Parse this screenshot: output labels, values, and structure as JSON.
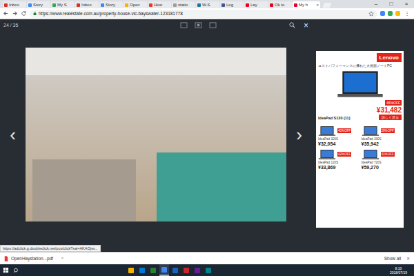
{
  "browser": {
    "tabs": [
      {
        "label": "Inbox",
        "selected": false,
        "color": "#d93025"
      },
      {
        "label": "Story",
        "selected": false,
        "color": "#4285f4"
      },
      {
        "label": "My S",
        "selected": false,
        "color": "#34a853"
      },
      {
        "label": "Inbox",
        "selected": false,
        "color": "#d93025"
      },
      {
        "label": "Story",
        "selected": false,
        "color": "#4285f4"
      },
      {
        "label": "Open",
        "selected": false,
        "color": "#f4b400"
      },
      {
        "label": "How",
        "selected": false,
        "color": "#e53935"
      },
      {
        "label": "statio",
        "selected": false,
        "color": "#9e9e9e"
      },
      {
        "label": "W-S",
        "selected": false,
        "color": "#21759b"
      },
      {
        "label": "Log",
        "selected": false,
        "color": "#3b5998"
      },
      {
        "label": "Lay",
        "selected": false,
        "color": "#e60023"
      },
      {
        "label": "Ok to",
        "selected": false,
        "color": "#e60023"
      },
      {
        "label": "My h",
        "selected": true,
        "color": "#e4002b"
      }
    ],
    "tab_close": "×",
    "window_controls": [
      "–",
      "□",
      "×"
    ],
    "url": "https://www.realestate.com.au/property-house-vic-bayswater-123181778",
    "menu": "⋮",
    "extensions": [
      {
        "color": "#4285f4"
      },
      {
        "color": "#34a853"
      },
      {
        "color": "#fbbc05"
      }
    ]
  },
  "gallery": {
    "counter": "24 / 35",
    "close": "×",
    "prev": "‹",
    "next": "›"
  },
  "ad": {
    "brand": "Lenovo",
    "headline": "コストパフォーマンスに優れた大画面ノートPC",
    "badge": "45%OFF",
    "product": "IdeaPad S130 (11)",
    "price": "¥31,482",
    "cta": "詳しく見る",
    "items": [
      {
        "name": "IdeaPad 320S",
        "badge": "40%OFF",
        "price": "¥32,054"
      },
      {
        "name": "IdeaPad 330S",
        "badge": "29%OFF",
        "price": "¥35,942"
      },
      {
        "name": "IdeaPad 120S",
        "badge": "42%OFF",
        "price": "¥33,869"
      },
      {
        "name": "IdeaPad 720S",
        "badge": "31%OFF",
        "price": "¥59,270"
      }
    ]
  },
  "status_url": "https://adclick.g.doubleclick.net/pcs/click?xai=AKAOjsv...",
  "downloads": {
    "file": "OpenHaystation...pdf",
    "caret": "^",
    "show_all": "Show all",
    "close": "×"
  },
  "taskbar": {
    "apps": [
      {
        "color": "#f4b400",
        "selected": false
      },
      {
        "color": "#0078d7",
        "selected": false
      },
      {
        "color": "#2e7d32",
        "selected": false
      },
      {
        "color": "#4285f4",
        "selected": true
      },
      {
        "color": "#1565c0",
        "selected": false
      },
      {
        "color": "#c62828",
        "selected": false
      },
      {
        "color": "#6a1b9a",
        "selected": false
      },
      {
        "color": "#00838f",
        "selected": false
      }
    ],
    "time": "8:10",
    "date": "2018/07/19"
  }
}
